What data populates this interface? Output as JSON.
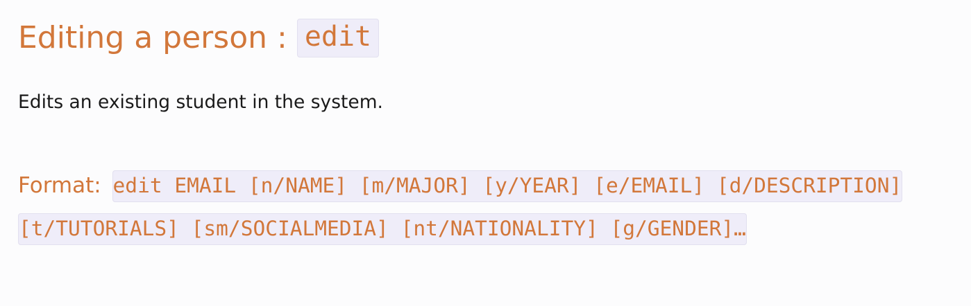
{
  "heading": {
    "title": "Editing a person : ",
    "command": "edit"
  },
  "description": "Edits an existing student in the system.",
  "format": {
    "label": "Format:",
    "command": "edit EMAIL [n/NAME] [m/MAJOR] [y/YEAR] [e/EMAIL] [d/DESCRIPTION] [t/TUTORIALS] [sm/SOCIALMEDIA] [nt/NATIONALITY] [g/GENDER]…"
  },
  "colors": {
    "heading": "#d2773a",
    "code_background": "#efedf9",
    "body_text": "#1a1a1a",
    "page_background": "#fcfcfd"
  }
}
